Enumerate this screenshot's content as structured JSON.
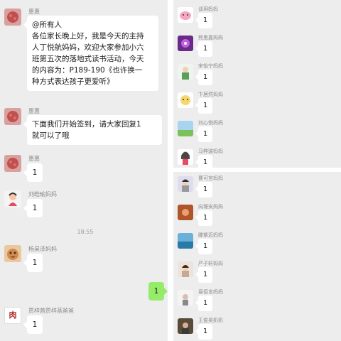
{
  "left_chat": {
    "messages": [
      {
        "sender": "惠惠",
        "text_lines": [
          "@所有人",
          "各位家长晚上好，我是今天的主持",
          "人丁悦航妈妈，欢迎大家参加小六",
          "班第五次的落地式读书活动，今天",
          "的内容为：P189-190《也许换一",
          "种方式表达孩子更爱听》"
        ]
      },
      {
        "sender": "惠惠",
        "text_lines": [
          "下面我们开始签到，请大家回复1",
          "就可以了哦"
        ]
      },
      {
        "sender": "惠惠",
        "text": "1"
      },
      {
        "sender": "刘皓瑜妈妈",
        "text": "1"
      },
      {
        "sender": "杨昊泽妈妈",
        "text": "1"
      },
      {
        "sender": "贾梓茜贾梓菡爸爸",
        "text": "1"
      }
    ],
    "timestamp": "18:55",
    "self_message": "1",
    "avatar_text": "肉"
  },
  "right_chat": {
    "items": [
      {
        "sender": "谈玥妈妈",
        "text": "1"
      },
      {
        "sender": "熊思嘉妈妈",
        "text": "1"
      },
      {
        "sender": "宋怡宁妈妈",
        "text": "1"
      },
      {
        "sender": "卞居然妈妈",
        "text": "1"
      },
      {
        "sender": "刘心悦妈妈",
        "text": "1"
      },
      {
        "sender": "马梓骏妈妈",
        "text": "1"
      },
      {
        "sender": "曹可言妈妈",
        "text": "1"
      },
      {
        "sender": "向璟安妈妈",
        "text": "1"
      },
      {
        "sender": "滕紫迈妈妈",
        "text": "1"
      },
      {
        "sender": "严子轩妈妈",
        "text": "1"
      },
      {
        "sender": "易佰言妈妈",
        "text": "1"
      },
      {
        "sender": "王俊昊奶奶",
        "text": "1"
      }
    ]
  },
  "colors": {
    "chat_background": "#ededed",
    "bubble_white": "#ffffff",
    "bubble_green": "#95ec69",
    "name_gray": "#8a8a8a"
  }
}
